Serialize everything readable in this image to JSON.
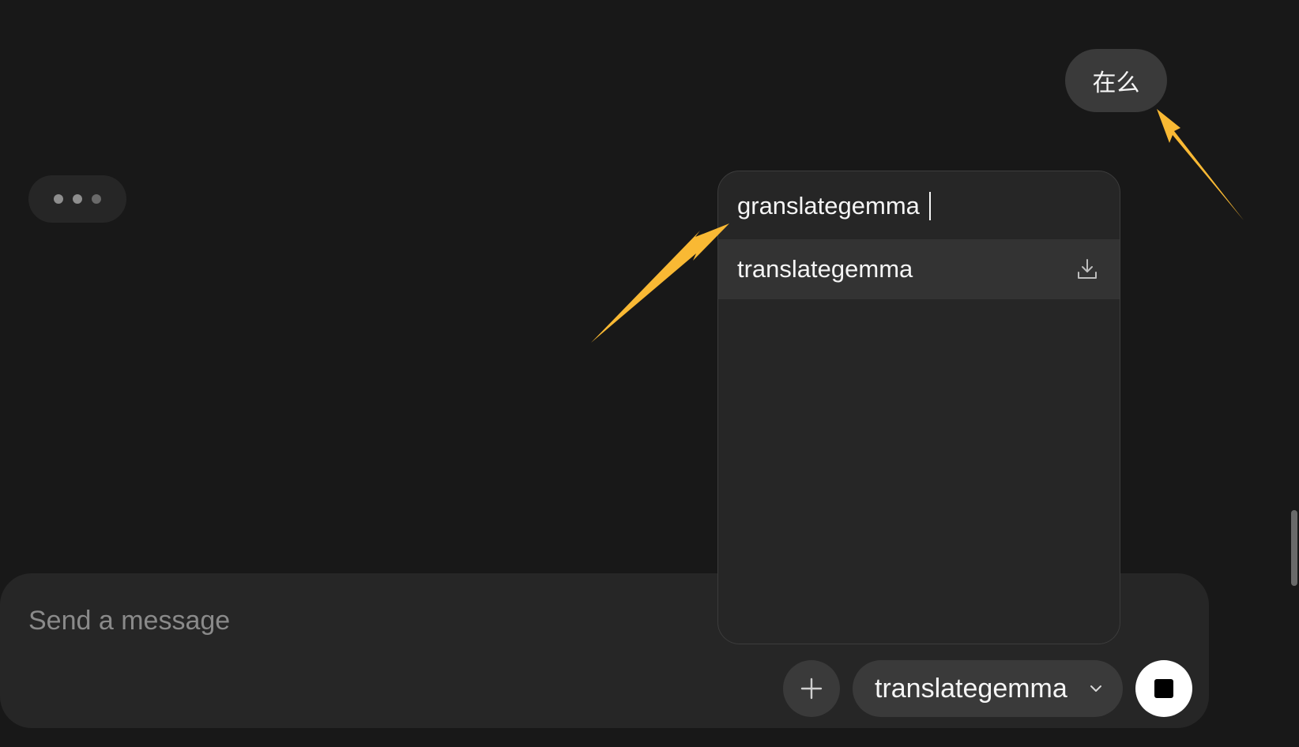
{
  "chat": {
    "user_message": "在么"
  },
  "composer": {
    "placeholder": "Send a message"
  },
  "model_picker": {
    "search_value": "granslategemma",
    "options": [
      {
        "label": "translategemma",
        "icon": "download-icon"
      }
    ],
    "selected_model": "translategemma"
  },
  "colors": {
    "background": "#181818",
    "surface": "#262626",
    "chip": "#3a3a3a",
    "annotation_arrow": "#f9b934"
  },
  "icons": {
    "typing": "typing-indicator",
    "attach": "plus-icon",
    "model_dropdown": "chevron-down-icon",
    "stop": "stop-icon",
    "option_action": "download-icon"
  }
}
